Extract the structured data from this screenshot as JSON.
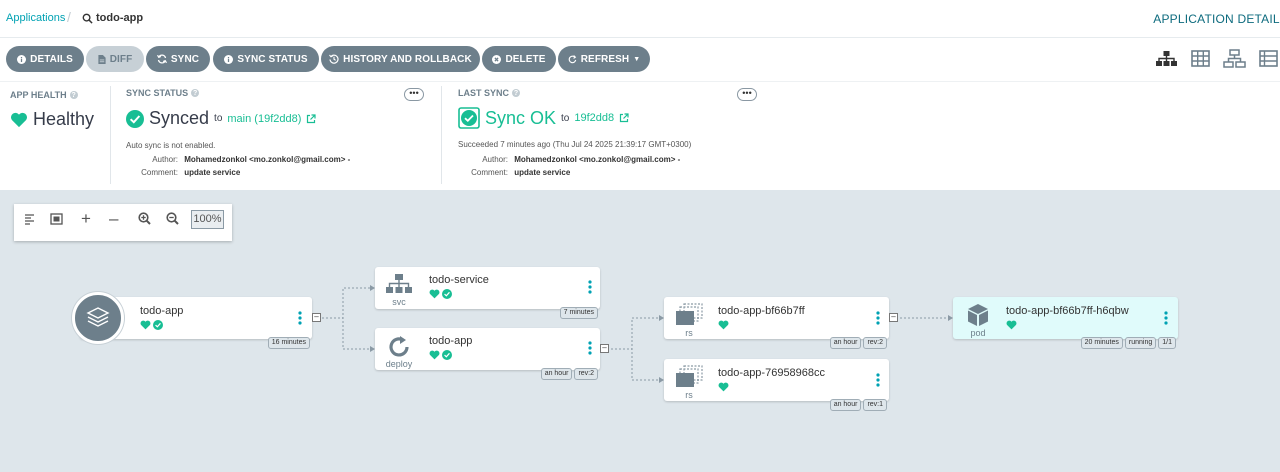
{
  "breadcrumb": {
    "root": "Applications",
    "current": "todo-app"
  },
  "header": {
    "title": "APPLICATION DETAILS"
  },
  "toolbar": {
    "buttons": [
      {
        "label": "DETAILS",
        "icon": "info-icon"
      },
      {
        "label": "DIFF",
        "icon": "file-icon"
      },
      {
        "label": "SYNC",
        "icon": "sync-icon"
      },
      {
        "label": "SYNC STATUS",
        "icon": "info-icon"
      },
      {
        "label": "HISTORY AND ROLLBACK",
        "icon": "history-icon"
      },
      {
        "label": "DELETE",
        "icon": "delete-icon"
      },
      {
        "label": "REFRESH",
        "icon": "refresh-icon"
      }
    ],
    "views": [
      "tree-view-icon",
      "pods-view-icon",
      "network-view-icon",
      "list-view-icon"
    ]
  },
  "health": {
    "label": "APP HEALTH",
    "value": "Healthy",
    "color": "#18be94"
  },
  "sync_status": {
    "label": "SYNC STATUS",
    "value": "Synced",
    "to": "to",
    "revision": "main (19f2dd8)",
    "note": "Auto sync is not enabled.",
    "author_label": "Author:",
    "author": "Mohamedzonkol <mo.zonkol@gmail.com> -",
    "comment_label": "Comment:",
    "comment": "update service"
  },
  "last_sync": {
    "label": "LAST SYNC",
    "value": "Sync OK",
    "to": "to",
    "revision": "19f2dd8",
    "succeeded": "Succeeded 7 minutes ago (Thu Jul 24 2025 21:39:17 GMT+0300)",
    "author_label": "Author:",
    "author": "Mohamedzonkol <mo.zonkol@gmail.com> -",
    "comment_label": "Comment:",
    "comment": "update service"
  },
  "graph": {
    "zoom": "100%",
    "nodes": {
      "app": {
        "name": "todo-app",
        "tags": [
          "16 minutes"
        ]
      },
      "svc": {
        "name": "todo-service",
        "kind": "svc",
        "tags": [
          "7 minutes"
        ]
      },
      "deploy": {
        "name": "todo-app",
        "kind": "deploy",
        "tags": [
          "an hour",
          "rev:2"
        ]
      },
      "rs1": {
        "name": "todo-app-bf66b7ff",
        "kind": "rs",
        "tags": [
          "an hour",
          "rev:2"
        ]
      },
      "rs2": {
        "name": "todo-app-76958968cc",
        "kind": "rs",
        "tags": [
          "an hour",
          "rev:1"
        ]
      },
      "pod": {
        "name": "todo-app-bf66b7ff-h6qbw",
        "kind": "pod",
        "tags": [
          "20 minutes",
          "running",
          "1/1"
        ]
      }
    }
  },
  "colors": {
    "accent": "#00a2b3",
    "healthy": "#18be94",
    "button": "#6d7f8b"
  }
}
